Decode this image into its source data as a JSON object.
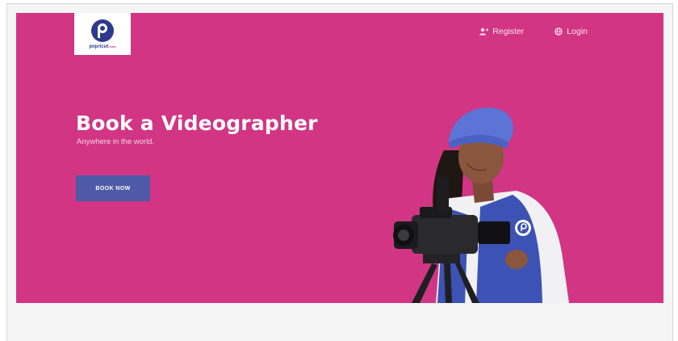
{
  "brand": {
    "name": "popricut",
    "suffix": ".com",
    "colors": {
      "primary": "#2d3a8c",
      "accent": "#d13584"
    }
  },
  "nav": [
    {
      "label": "Register",
      "icon": "add-user-icon"
    },
    {
      "label": "Login",
      "icon": "globe-icon"
    }
  ],
  "hero": {
    "title": "Book a Videographer",
    "subtitle": "Anywhere in the world.",
    "cta": "BOOK NOW",
    "background": "#d13584",
    "button_color": "#4e5aa5"
  }
}
